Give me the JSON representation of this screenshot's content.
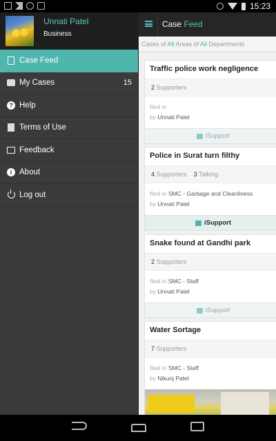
{
  "status_bar": {
    "time": "15:23",
    "icons": [
      "screenshot-icon",
      "gmail-icon",
      "chrome-icon",
      "message-icon",
      "alarm-icon",
      "wifi-icon",
      "battery-icon"
    ]
  },
  "drawer": {
    "user": {
      "name": "Unnati Patel",
      "role": "Business"
    },
    "items": [
      {
        "label": "Case Feed",
        "icon": "case-feed-icon",
        "active": true,
        "count": ""
      },
      {
        "label": "My Cases",
        "icon": "my-cases-icon",
        "active": false,
        "count": "15"
      },
      {
        "label": "Help",
        "icon": "help-icon",
        "active": false,
        "count": ""
      },
      {
        "label": "Terms of Use",
        "icon": "terms-icon",
        "active": false,
        "count": ""
      },
      {
        "label": "Feedback",
        "icon": "feedback-icon",
        "active": false,
        "count": ""
      },
      {
        "label": "About",
        "icon": "about-icon",
        "active": false,
        "count": ""
      },
      {
        "label": "Log out",
        "icon": "logout-icon",
        "active": false,
        "count": ""
      }
    ]
  },
  "action_bar": {
    "title_main": "Case",
    "title_accent": "Feed"
  },
  "filter": {
    "p1": "Cases of ",
    "all1": "All",
    "p2": " Areas of ",
    "all2": "All",
    "p3": " Departments"
  },
  "cards": [
    {
      "title": "Traffic police work negligence",
      "supporters": "2",
      "supporters_label": "Supporters",
      "talking": "",
      "talking_label": "",
      "filed_in_label": "filed in",
      "filed_in": "",
      "by_label": "by",
      "by": "Unnati Patel",
      "support_label": "iSupport",
      "pressed": false
    },
    {
      "title": "Police in Surat turn filthy",
      "supporters": "4",
      "supporters_label": "Supporters",
      "talking": "3",
      "talking_label": "Talking",
      "filed_in_label": "filed in",
      "filed_in": "SMC - Garbage and Cleanliness",
      "by_label": "by",
      "by": "Unnati Patel",
      "support_label": "iSupport",
      "pressed": true
    },
    {
      "title": "Snake found at Gandhi park",
      "supporters": "2",
      "supporters_label": "Supporters",
      "talking": "",
      "talking_label": "",
      "filed_in_label": "filed in",
      "filed_in": "SMC - Staff",
      "by_label": "by",
      "by": "Unnati Patel",
      "support_label": "iSupport",
      "pressed": false
    },
    {
      "title": "Water Sortage",
      "supporters": "7",
      "supporters_label": "Supporters",
      "talking": "",
      "talking_label": "",
      "filed_in_label": "filed in",
      "filed_in": "SMC - Staff",
      "by_label": "by",
      "by": "Nikunj Patel",
      "support_label": "",
      "pressed": false
    }
  ],
  "nav": {
    "back": "back-icon",
    "home": "home-icon",
    "recents": "recents-icon"
  }
}
